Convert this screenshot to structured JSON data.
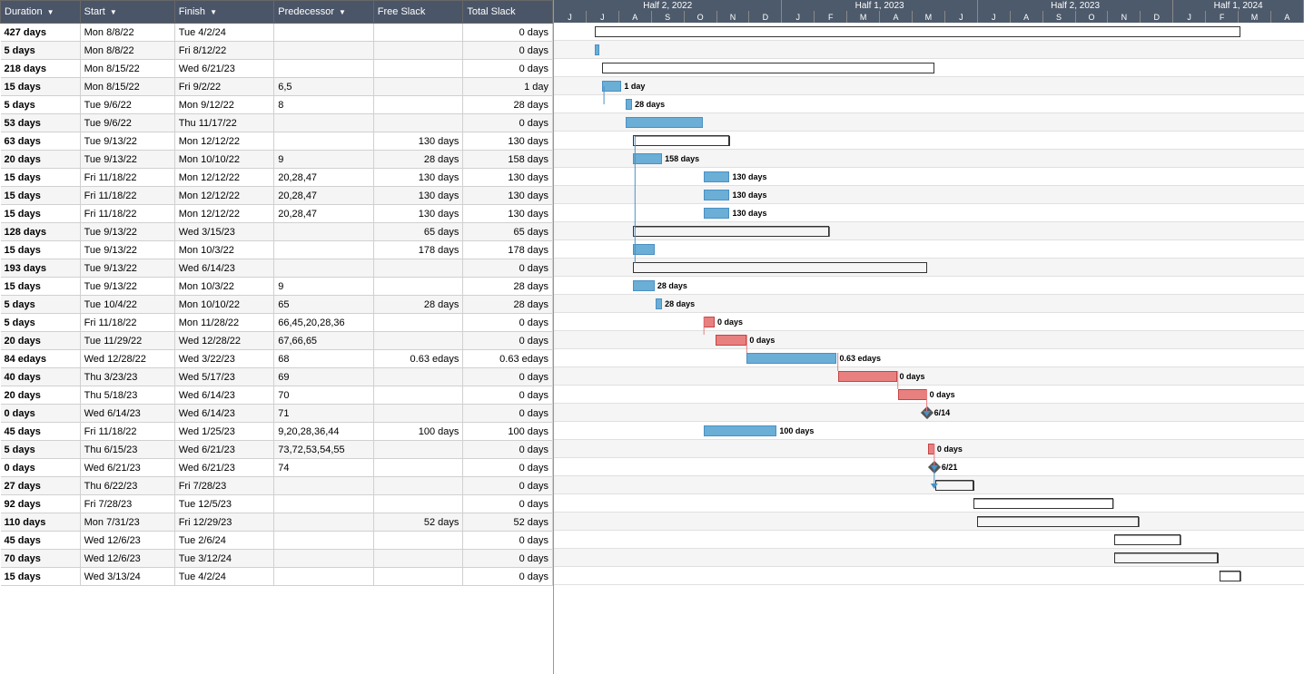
{
  "header": {
    "columns": [
      {
        "label": "Duration",
        "sort": true
      },
      {
        "label": "Start",
        "sort": true
      },
      {
        "label": "Finish",
        "sort": true
      },
      {
        "label": "Predecessor",
        "sort": true
      },
      {
        "label": "Free Slack",
        "sort": false
      },
      {
        "label": "Total Slack",
        "sort": false
      }
    ]
  },
  "rows": [
    {
      "duration": "427 days",
      "start": "Mon 8/8/22",
      "finish": "Tue 4/2/24",
      "pred": "",
      "freeSlack": "",
      "totalSlack": "0 days"
    },
    {
      "duration": "5 days",
      "start": "Mon 8/8/22",
      "finish": "Fri 8/12/22",
      "pred": "",
      "freeSlack": "",
      "totalSlack": "0 days"
    },
    {
      "duration": "218 days",
      "start": "Mon 8/15/22",
      "finish": "Wed 6/21/23",
      "pred": "",
      "freeSlack": "",
      "totalSlack": "0 days"
    },
    {
      "duration": "15 days",
      "start": "Mon 8/15/22",
      "finish": "Fri 9/2/22",
      "pred": "6,5",
      "freeSlack": "",
      "totalSlack": "1 day"
    },
    {
      "duration": "5 days",
      "start": "Tue 9/6/22",
      "finish": "Mon 9/12/22",
      "pred": "8",
      "freeSlack": "",
      "totalSlack": "28 days"
    },
    {
      "duration": "53 days",
      "start": "Tue 9/6/22",
      "finish": "Thu 11/17/22",
      "pred": "",
      "freeSlack": "",
      "totalSlack": "0 days"
    },
    {
      "duration": "63 days",
      "start": "Tue 9/13/22",
      "finish": "Mon 12/12/22",
      "pred": "",
      "freeSlack": "130 days",
      "totalSlack": "130 days"
    },
    {
      "duration": "20 days",
      "start": "Tue 9/13/22",
      "finish": "Mon 10/10/22",
      "pred": "9",
      "freeSlack": "28 days",
      "totalSlack": "158 days"
    },
    {
      "duration": "15 days",
      "start": "Fri 11/18/22",
      "finish": "Mon 12/12/22",
      "pred": "20,28,47",
      "freeSlack": "130 days",
      "totalSlack": "130 days"
    },
    {
      "duration": "15 days",
      "start": "Fri 11/18/22",
      "finish": "Mon 12/12/22",
      "pred": "20,28,47",
      "freeSlack": "130 days",
      "totalSlack": "130 days"
    },
    {
      "duration": "15 days",
      "start": "Fri 11/18/22",
      "finish": "Mon 12/12/22",
      "pred": "20,28,47",
      "freeSlack": "130 days",
      "totalSlack": "130 days"
    },
    {
      "duration": "128 days",
      "start": "Tue 9/13/22",
      "finish": "Wed 3/15/23",
      "pred": "",
      "freeSlack": "65 days",
      "totalSlack": "65 days"
    },
    {
      "duration": "15 days",
      "start": "Tue 9/13/22",
      "finish": "Mon 10/3/22",
      "pred": "",
      "freeSlack": "178 days",
      "totalSlack": "178 days"
    },
    {
      "duration": "193 days",
      "start": "Tue 9/13/22",
      "finish": "Wed 6/14/23",
      "pred": "",
      "freeSlack": "",
      "totalSlack": "0 days"
    },
    {
      "duration": "15 days",
      "start": "Tue 9/13/22",
      "finish": "Mon 10/3/22",
      "pred": "9",
      "freeSlack": "",
      "totalSlack": "28 days"
    },
    {
      "duration": "5 days",
      "start": "Tue 10/4/22",
      "finish": "Mon 10/10/22",
      "pred": "65",
      "freeSlack": "28 days",
      "totalSlack": "28 days"
    },
    {
      "duration": "5 days",
      "start": "Fri 11/18/22",
      "finish": "Mon 11/28/22",
      "pred": "66,45,20,28,36",
      "freeSlack": "",
      "totalSlack": "0 days"
    },
    {
      "duration": "20 days",
      "start": "Tue 11/29/22",
      "finish": "Wed 12/28/22",
      "pred": "67,66,65",
      "freeSlack": "",
      "totalSlack": "0 days"
    },
    {
      "duration": "84 edays",
      "start": "Wed 12/28/22",
      "finish": "Wed 3/22/23",
      "pred": "68",
      "freeSlack": "0.63 edays",
      "totalSlack": "0.63 edays"
    },
    {
      "duration": "40 days",
      "start": "Thu 3/23/23",
      "finish": "Wed 5/17/23",
      "pred": "69",
      "freeSlack": "",
      "totalSlack": "0 days"
    },
    {
      "duration": "20 days",
      "start": "Thu 5/18/23",
      "finish": "Wed 6/14/23",
      "pred": "70",
      "freeSlack": "",
      "totalSlack": "0 days"
    },
    {
      "duration": "0 days",
      "start": "Wed 6/14/23",
      "finish": "Wed 6/14/23",
      "pred": "71",
      "freeSlack": "",
      "totalSlack": "0 days"
    },
    {
      "duration": "45 days",
      "start": "Fri 11/18/22",
      "finish": "Wed 1/25/23",
      "pred": "9,20,28,36,44",
      "freeSlack": "100 days",
      "totalSlack": "100 days"
    },
    {
      "duration": "5 days",
      "start": "Thu 6/15/23",
      "finish": "Wed 6/21/23",
      "pred": "73,72,53,54,55",
      "freeSlack": "",
      "totalSlack": "0 days"
    },
    {
      "duration": "0 days",
      "start": "Wed 6/21/23",
      "finish": "Wed 6/21/23",
      "pred": "74",
      "freeSlack": "",
      "totalSlack": "0 days"
    },
    {
      "duration": "27 days",
      "start": "Thu 6/22/23",
      "finish": "Fri 7/28/23",
      "pred": "",
      "freeSlack": "",
      "totalSlack": "0 days"
    },
    {
      "duration": "92 days",
      "start": "Fri 7/28/23",
      "finish": "Tue 12/5/23",
      "pred": "",
      "freeSlack": "",
      "totalSlack": "0 days"
    },
    {
      "duration": "110 days",
      "start": "Mon 7/31/23",
      "finish": "Fri 12/29/23",
      "pred": "",
      "freeSlack": "52 days",
      "totalSlack": "52 days"
    },
    {
      "duration": "45 days",
      "start": "Wed 12/6/23",
      "finish": "Tue 2/6/24",
      "pred": "",
      "freeSlack": "",
      "totalSlack": "0 days"
    },
    {
      "duration": "70 days",
      "start": "Wed 12/6/23",
      "finish": "Tue 3/12/24",
      "pred": "",
      "freeSlack": "",
      "totalSlack": "0 days"
    },
    {
      "duration": "15 days",
      "start": "Wed 3/13/24",
      "finish": "Tue 4/2/24",
      "pred": "",
      "freeSlack": "",
      "totalSlack": "0 days"
    }
  ],
  "gantt": {
    "timelineStart": "2022-07-01",
    "periods": [
      {
        "label": "Half 2, 2022",
        "months": [
          "J",
          "J",
          "A",
          "S",
          "O",
          "N",
          "D"
        ]
      },
      {
        "label": "Half 1, 2023",
        "months": [
          "J",
          "F",
          "M",
          "A",
          "M",
          "J"
        ]
      },
      {
        "label": "Half 2, 2023",
        "months": [
          "J",
          "A",
          "S",
          "O",
          "N",
          "D"
        ]
      },
      {
        "label": "Half 1, 2024",
        "months": [
          "J",
          "F",
          "M",
          "A"
        ]
      }
    ]
  },
  "colors": {
    "header_bg": "#4d5a6b",
    "bar_blue": "#6baed6",
    "bar_red": "#e88080",
    "bar_border_blue": "#4a90c4",
    "bar_border_red": "#c44444",
    "text_white": "#ffffff"
  }
}
